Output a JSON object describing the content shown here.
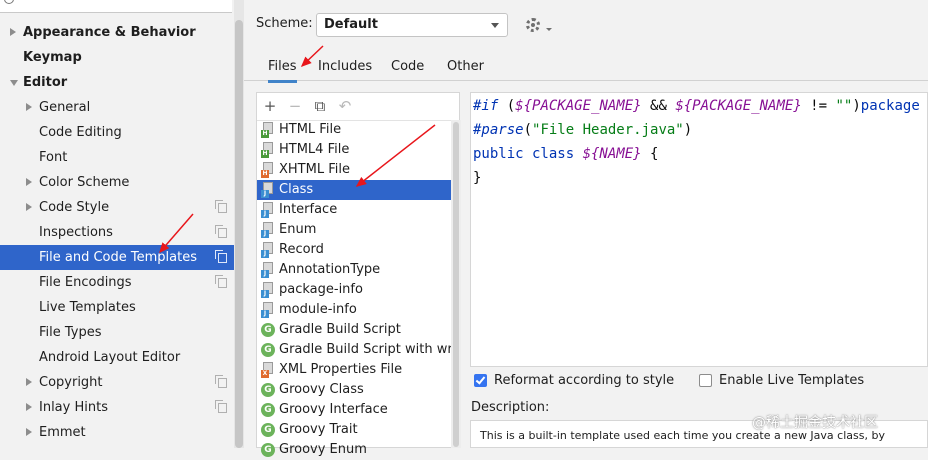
{
  "sidebar": {
    "items": [
      {
        "label": "Appearance & Behavior",
        "bold": true,
        "indent": 0,
        "chevron": "right",
        "copy": false,
        "selected": false
      },
      {
        "label": "Keymap",
        "bold": true,
        "indent": 0,
        "chevron": "none",
        "copy": false,
        "selected": false
      },
      {
        "label": "Editor",
        "bold": true,
        "indent": 0,
        "chevron": "down",
        "copy": false,
        "selected": false
      },
      {
        "label": "General",
        "bold": false,
        "indent": 1,
        "chevron": "right",
        "copy": false,
        "selected": false
      },
      {
        "label": "Code Editing",
        "bold": false,
        "indent": 1,
        "chevron": "none",
        "copy": false,
        "selected": false
      },
      {
        "label": "Font",
        "bold": false,
        "indent": 1,
        "chevron": "none",
        "copy": false,
        "selected": false
      },
      {
        "label": "Color Scheme",
        "bold": false,
        "indent": 1,
        "chevron": "right",
        "copy": false,
        "selected": false
      },
      {
        "label": "Code Style",
        "bold": false,
        "indent": 1,
        "chevron": "right",
        "copy": true,
        "selected": false
      },
      {
        "label": "Inspections",
        "bold": false,
        "indent": 1,
        "chevron": "none",
        "copy": true,
        "selected": false
      },
      {
        "label": "File and Code Templates",
        "bold": false,
        "indent": 1,
        "chevron": "none",
        "copy": true,
        "selected": true
      },
      {
        "label": "File Encodings",
        "bold": false,
        "indent": 1,
        "chevron": "none",
        "copy": true,
        "selected": false
      },
      {
        "label": "Live Templates",
        "bold": false,
        "indent": 1,
        "chevron": "none",
        "copy": false,
        "selected": false
      },
      {
        "label": "File Types",
        "bold": false,
        "indent": 1,
        "chevron": "none",
        "copy": false,
        "selected": false
      },
      {
        "label": "Android Layout Editor",
        "bold": false,
        "indent": 1,
        "chevron": "none",
        "copy": false,
        "selected": false
      },
      {
        "label": "Copyright",
        "bold": false,
        "indent": 1,
        "chevron": "right",
        "copy": true,
        "selected": false
      },
      {
        "label": "Inlay Hints",
        "bold": false,
        "indent": 1,
        "chevron": "right",
        "copy": true,
        "selected": false
      },
      {
        "label": "Emmet",
        "bold": false,
        "indent": 1,
        "chevron": "right",
        "copy": false,
        "selected": false
      }
    ]
  },
  "scheme": {
    "label": "Scheme:",
    "value": "Default"
  },
  "tabs": [
    {
      "label": "Files",
      "active": true
    },
    {
      "label": "Includes",
      "active": false
    },
    {
      "label": "Code",
      "active": false
    },
    {
      "label": "Other",
      "active": false
    }
  ],
  "toolbar": {
    "add": "+",
    "remove": "−",
    "copy": "⧉",
    "reset": "↶"
  },
  "templates": [
    {
      "label": "HTML File",
      "icon": "html-file-icon",
      "tag": "H",
      "tag_color": "#4a9a3b",
      "selected": false
    },
    {
      "label": "HTML4 File",
      "icon": "html-file-icon",
      "tag": "H",
      "tag_color": "#4a9a3b",
      "selected": false
    },
    {
      "label": "XHTML File",
      "icon": "xhtml-file-icon",
      "tag": "H",
      "tag_color": "#e06b2e",
      "selected": false
    },
    {
      "label": "Class",
      "icon": "java-class-icon",
      "tag": "J",
      "tag_color": "#3c8fd1",
      "selected": true
    },
    {
      "label": "Interface",
      "icon": "java-interface-icon",
      "tag": "J",
      "tag_color": "#3c8fd1",
      "selected": false
    },
    {
      "label": "Enum",
      "icon": "java-enum-icon",
      "tag": "J",
      "tag_color": "#3c8fd1",
      "selected": false
    },
    {
      "label": "Record",
      "icon": "java-record-icon",
      "tag": "J",
      "tag_color": "#3c8fd1",
      "selected": false
    },
    {
      "label": "AnnotationType",
      "icon": "java-annotation-icon",
      "tag": "J",
      "tag_color": "#3c8fd1",
      "selected": false
    },
    {
      "label": "package-info",
      "icon": "java-file-icon",
      "tag": "J",
      "tag_color": "#3c8fd1",
      "selected": false
    },
    {
      "label": "module-info",
      "icon": "java-file-icon",
      "tag": "J",
      "tag_color": "#3c8fd1",
      "selected": false
    },
    {
      "label": "Gradle Build Script",
      "icon": "gradle-icon",
      "tag": "G",
      "tag_color": "#6cb35b",
      "selected": false
    },
    {
      "label": "Gradle Build Script with wrappe",
      "icon": "gradle-icon",
      "tag": "G",
      "tag_color": "#6cb35b",
      "selected": false
    },
    {
      "label": "XML Properties File",
      "icon": "xml-file-icon",
      "tag": "X",
      "tag_color": "#e06b2e",
      "selected": false
    },
    {
      "label": "Groovy Class",
      "icon": "groovy-icon",
      "tag": "G",
      "tag_color": "#6cb35b",
      "selected": false
    },
    {
      "label": "Groovy Interface",
      "icon": "groovy-icon",
      "tag": "G",
      "tag_color": "#6cb35b",
      "selected": false
    },
    {
      "label": "Groovy Trait",
      "icon": "groovy-icon",
      "tag": "G",
      "tag_color": "#6cb35b",
      "selected": false
    },
    {
      "label": "Groovy Enum",
      "icon": "groovy-icon",
      "tag": "G",
      "tag_color": "#6cb35b",
      "selected": false
    }
  ],
  "editor": {
    "lines": [
      [
        {
          "t": "#if",
          "c": "dir"
        },
        {
          "t": " (",
          "c": "plain"
        },
        {
          "t": "${PACKAGE_NAME}",
          "c": "var"
        },
        {
          "t": " && ",
          "c": "plain"
        },
        {
          "t": "${PACKAGE_NAME}",
          "c": "var"
        },
        {
          "t": " != ",
          "c": "plain"
        },
        {
          "t": "\"\"",
          "c": "str"
        },
        {
          "t": ")",
          "c": "plain"
        },
        {
          "t": "package",
          "c": "kw"
        }
      ],
      [
        {
          "t": "#parse",
          "c": "dir"
        },
        {
          "t": "(",
          "c": "plain"
        },
        {
          "t": "\"File Header.java\"",
          "c": "str"
        },
        {
          "t": ")",
          "c": "plain"
        }
      ],
      [
        {
          "t": "public class ",
          "c": "kw"
        },
        {
          "t": "${NAME}",
          "c": "var"
        },
        {
          "t": " {",
          "c": "plain"
        }
      ],
      [
        {
          "t": "}",
          "c": "plain"
        }
      ]
    ]
  },
  "options": {
    "reformat": {
      "label": "Reformat according to style",
      "checked": true
    },
    "live_templates": {
      "label": "Enable Live Templates",
      "checked": false
    }
  },
  "description": {
    "label": "Description:",
    "text": "This is a built-in template used each time you create a new Java class, by"
  },
  "watermark": "@稀土掘金技术社区",
  "colors": {
    "selection": "#2f65ca",
    "accent": "#4083c9",
    "annotation": "#e8161b"
  }
}
